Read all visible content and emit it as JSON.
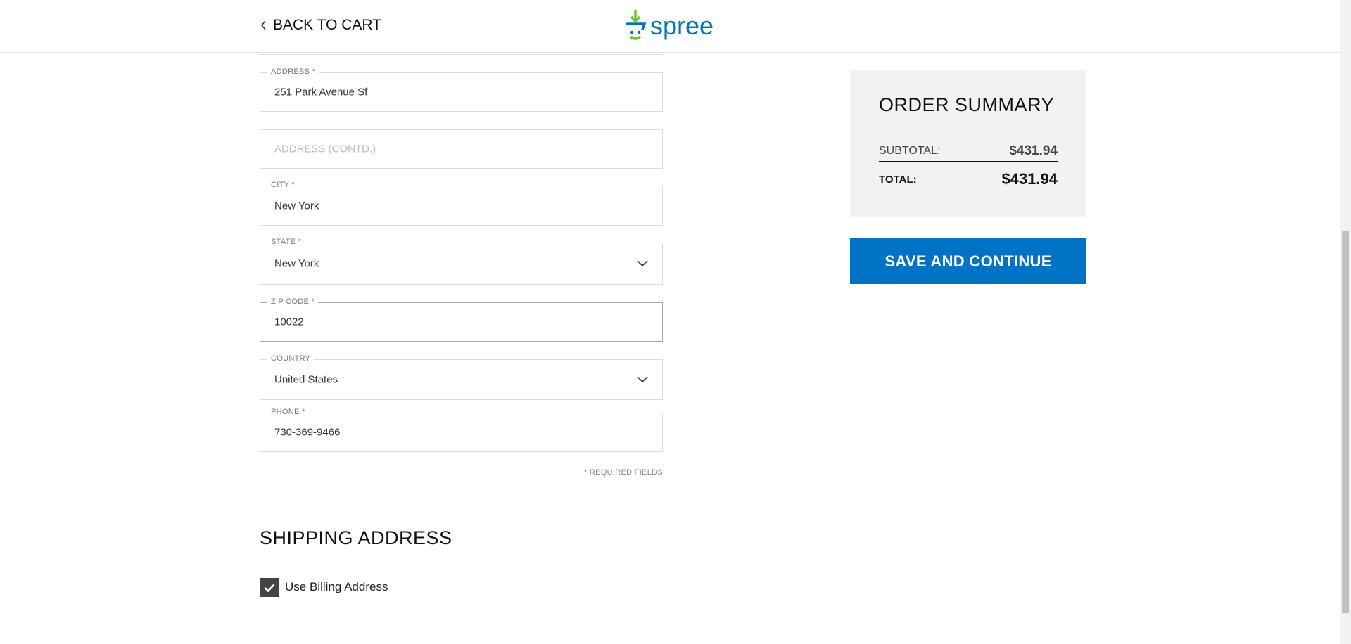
{
  "header": {
    "back_label": "BACK TO CART",
    "logo_text": "spree"
  },
  "form": {
    "address": {
      "label": "ADDRESS *",
      "value": "251 Park Avenue Sf"
    },
    "address2": {
      "placeholder": "ADDRESS (CONTD.)"
    },
    "city": {
      "label": "CITY *",
      "value": "New York"
    },
    "state": {
      "label": "STATE *",
      "value": "New York"
    },
    "zip": {
      "label": "ZIP CODE *",
      "value": "10022"
    },
    "country": {
      "label": "COUNTRY",
      "value": "United States"
    },
    "phone": {
      "label": "PHONE *",
      "value": "730-369-9466"
    },
    "required_note": "* REQUIRED FIELDS"
  },
  "shipping": {
    "title": "SHIPPING ADDRESS",
    "use_billing_label": "Use Billing Address",
    "use_billing_checked": true
  },
  "summary": {
    "title": "ORDER SUMMARY",
    "subtotal_label": "SUBTOTAL:",
    "subtotal": "$431.94",
    "total_label": "TOTAL:",
    "total": "$431.94"
  },
  "actions": {
    "save_label": "SAVE AND CONTINUE"
  },
  "colors": {
    "accent": "#0073c4",
    "logo_green": "#6cc62c"
  }
}
